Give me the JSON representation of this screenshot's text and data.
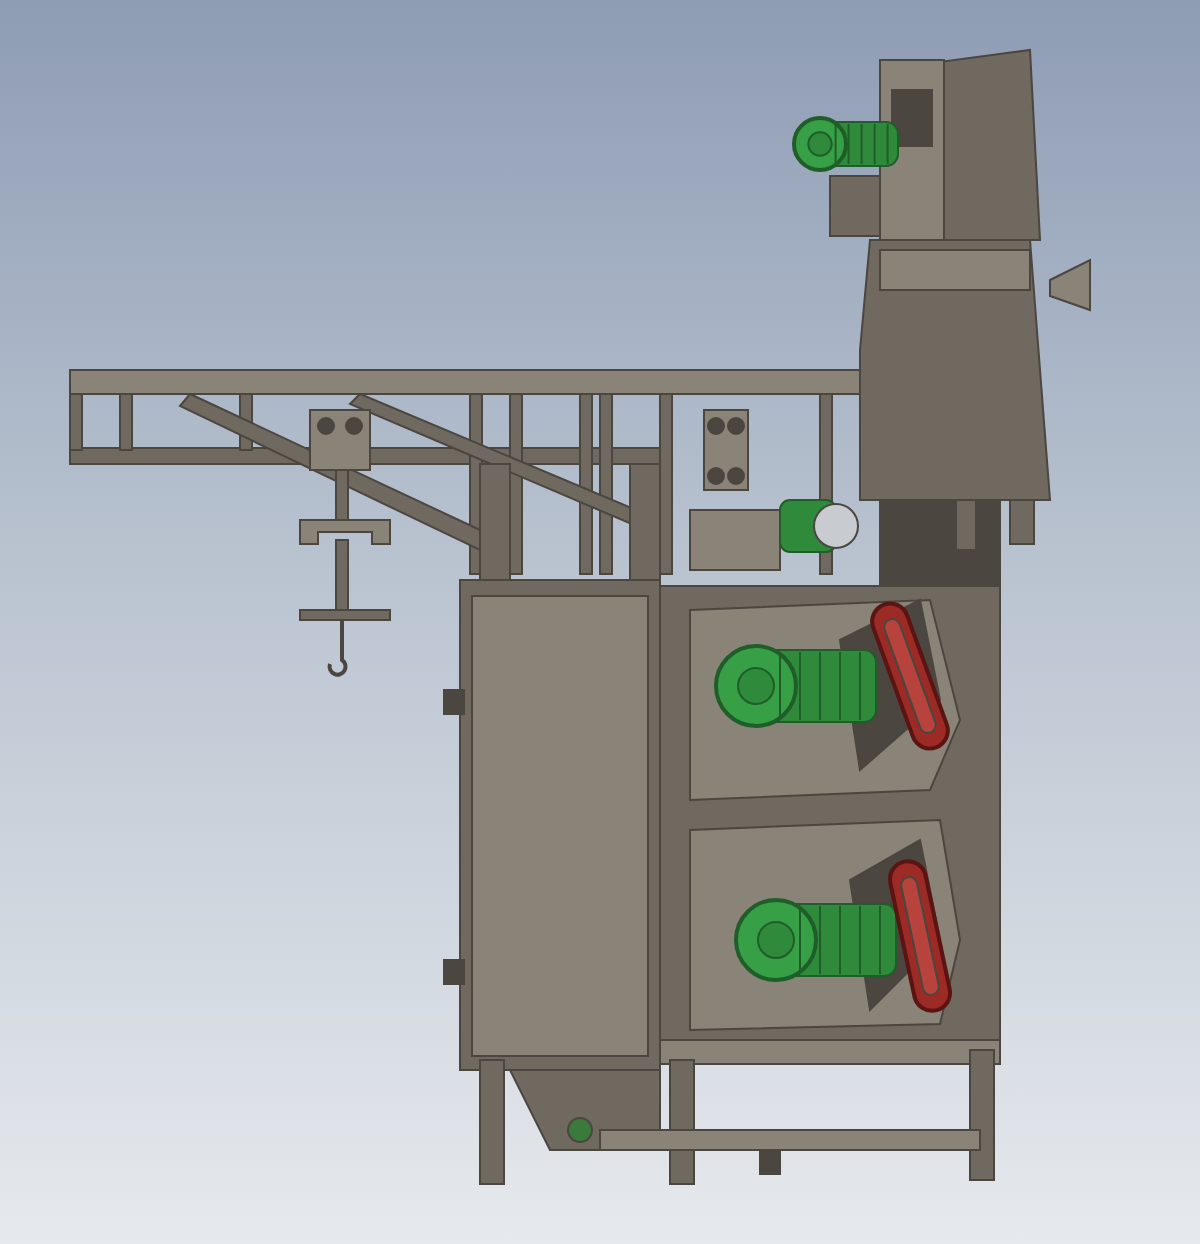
{
  "scene": {
    "kind": "machine-render"
  }
}
